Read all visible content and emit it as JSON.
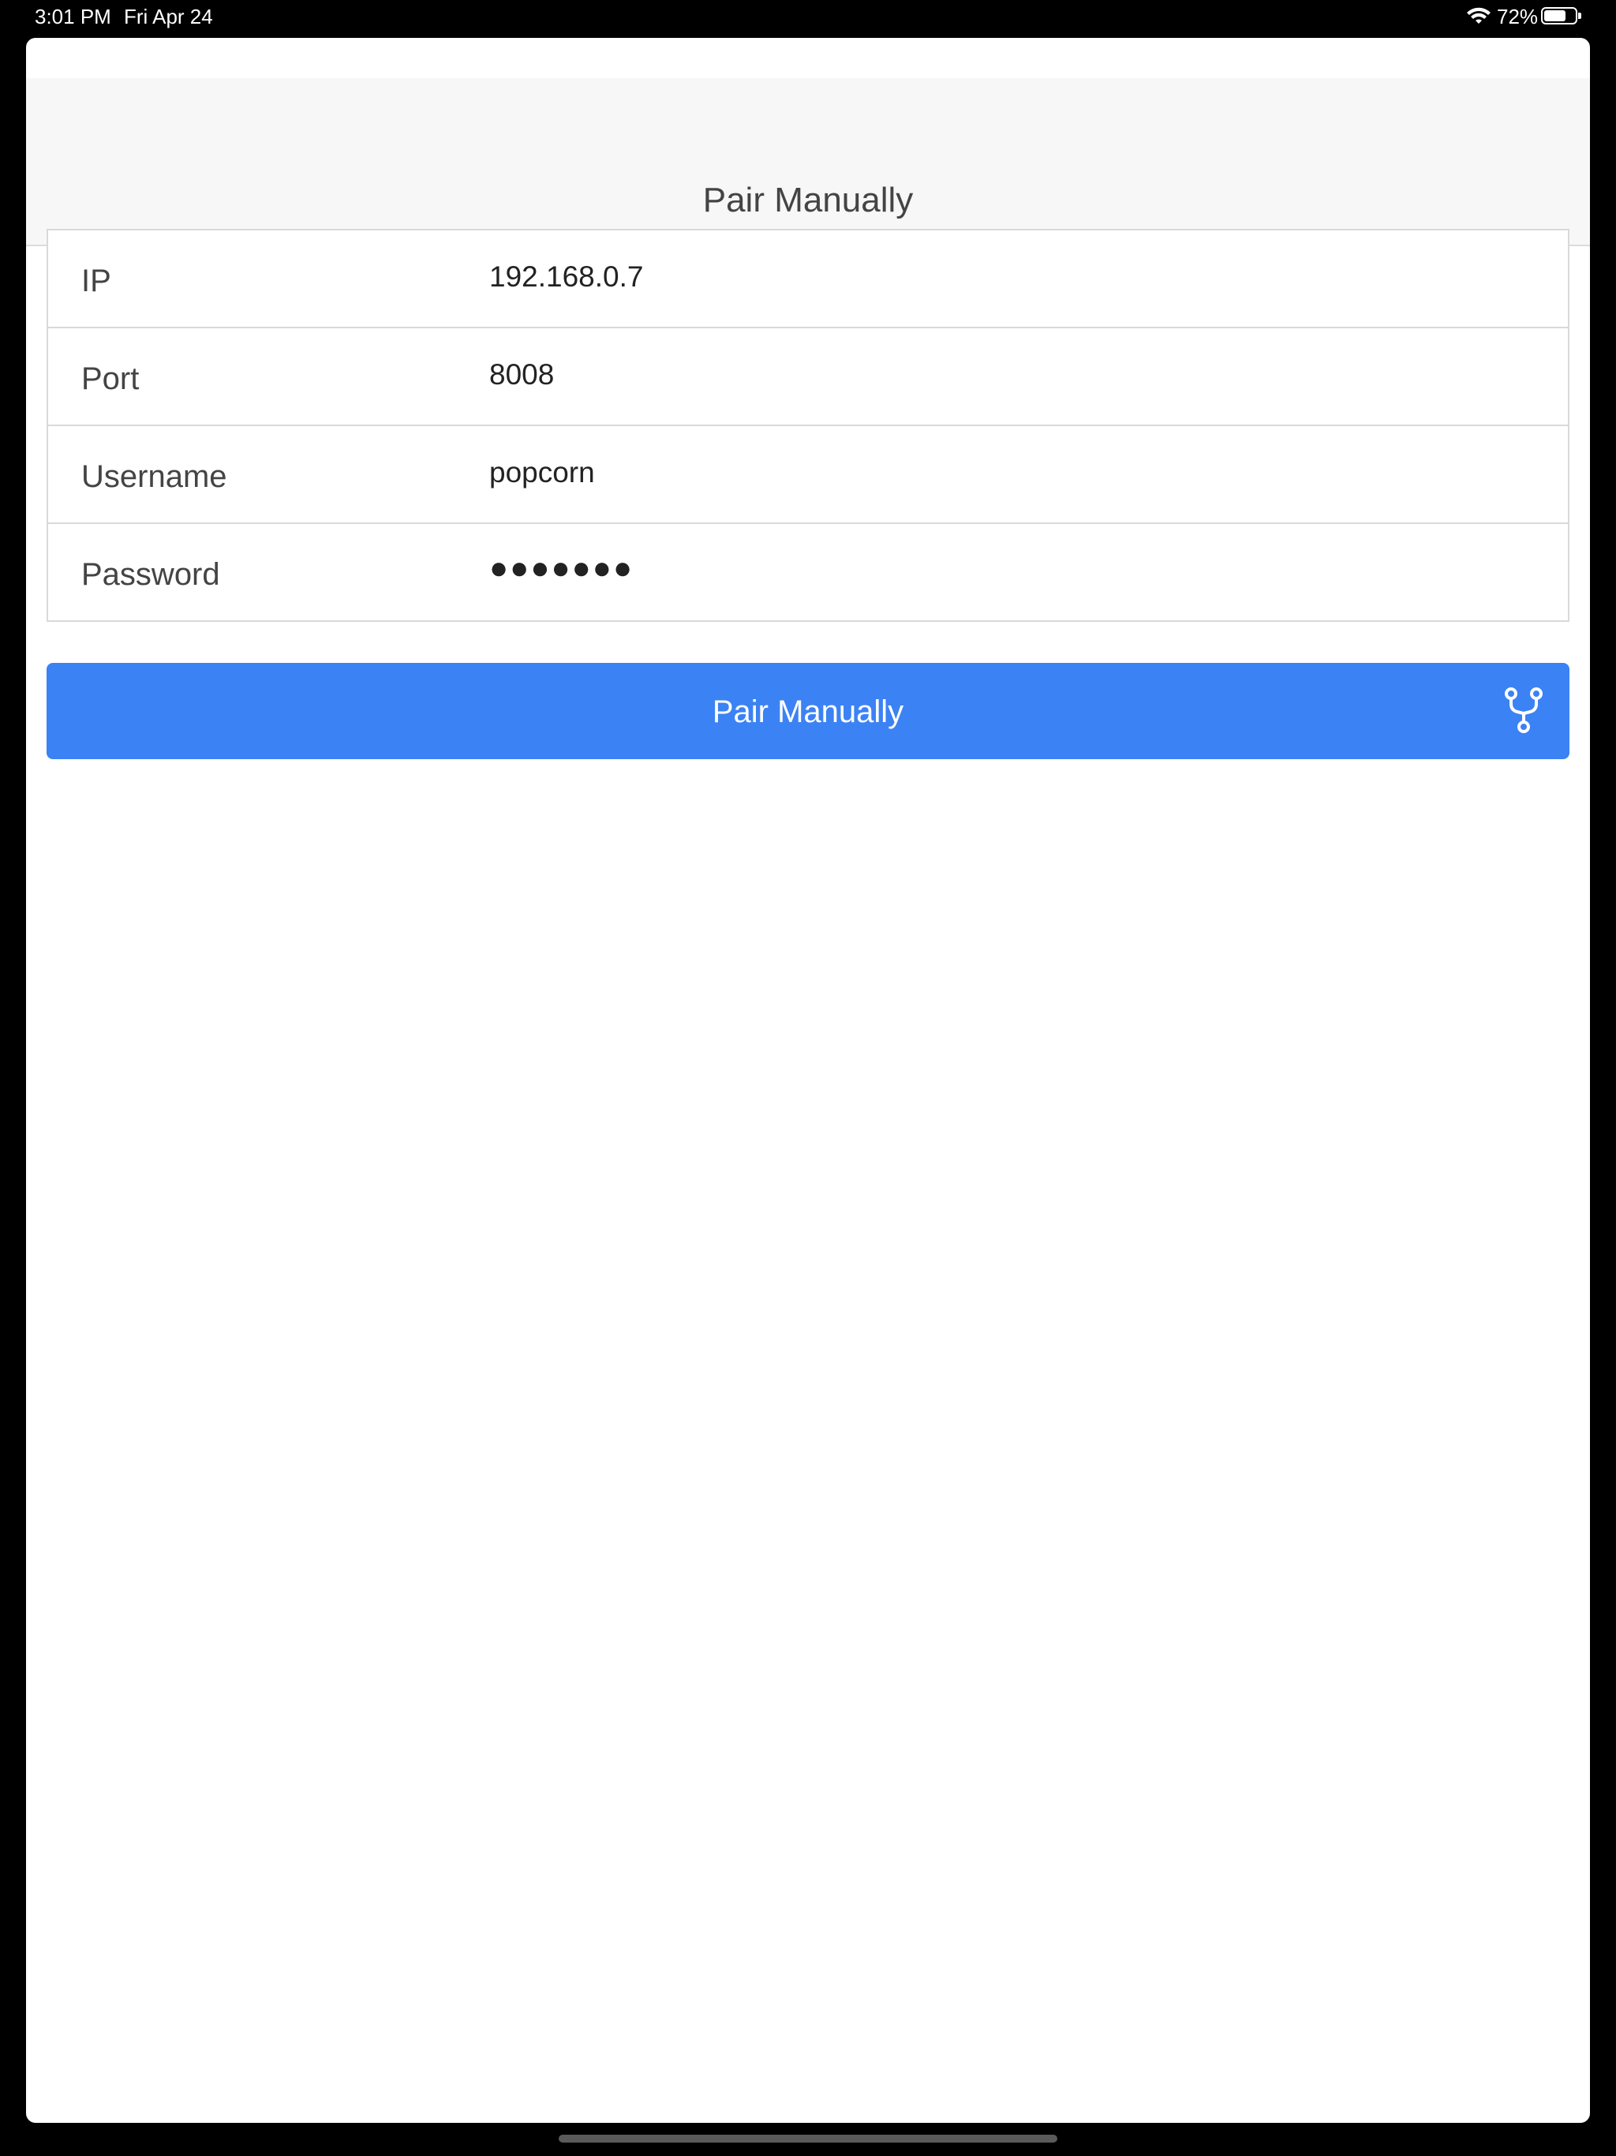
{
  "status_bar": {
    "time": "3:01 PM",
    "date": "Fri Apr 24",
    "battery_percent_label": "72%",
    "battery_level": 0.72
  },
  "nav": {
    "title": "Pair Manually"
  },
  "form": {
    "rows": [
      {
        "label": "IP",
        "value": "192.168.0.7"
      },
      {
        "label": "Port",
        "value": "8008"
      },
      {
        "label": "Username",
        "value": "popcorn"
      },
      {
        "label": "Password",
        "value": "●●●●●●●"
      }
    ]
  },
  "button": {
    "label": "Pair Manually",
    "icon": "fork-icon"
  },
  "colors": {
    "accent": "#3b82f4",
    "nav_background": "#f7f7f7"
  }
}
